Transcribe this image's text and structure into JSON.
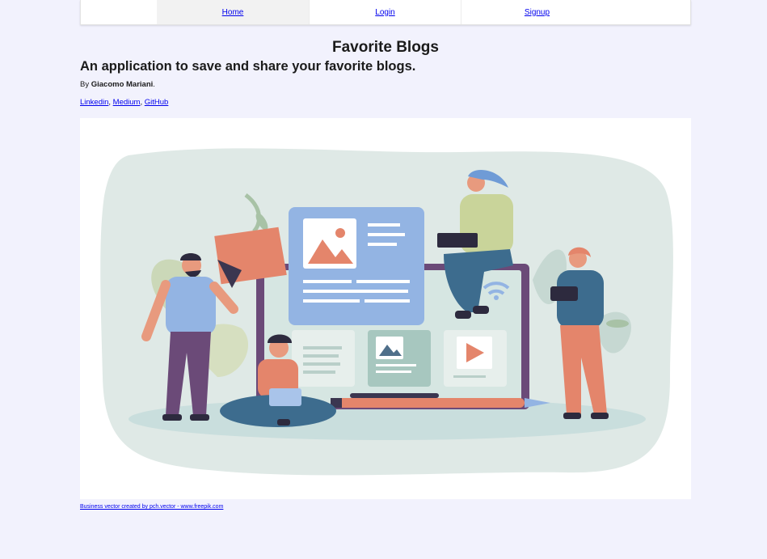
{
  "nav": {
    "items": [
      {
        "label": "Home"
      },
      {
        "label": "Login"
      },
      {
        "label": "Signup"
      }
    ]
  },
  "page": {
    "title": "Favorite Blogs",
    "subtitle": "An application to save and share your favorite blogs.",
    "byline_prefix": "By",
    "author": "Giacomo Mariani",
    "byline_suffix": ".",
    "links": [
      "Linkedin",
      "Medium",
      "GitHub"
    ],
    "separator": ", "
  },
  "footer": {
    "credit": "Business vector created by pch.vector - www.freepik.com"
  },
  "colors": {
    "background": "#f2f2fd",
    "link": "#0000ee",
    "illustration_blob": "#dfe9e6",
    "illustration_accent": "#e4856b",
    "illustration_blue": "#93b4e3",
    "illustration_purple": "#6b4a78"
  }
}
